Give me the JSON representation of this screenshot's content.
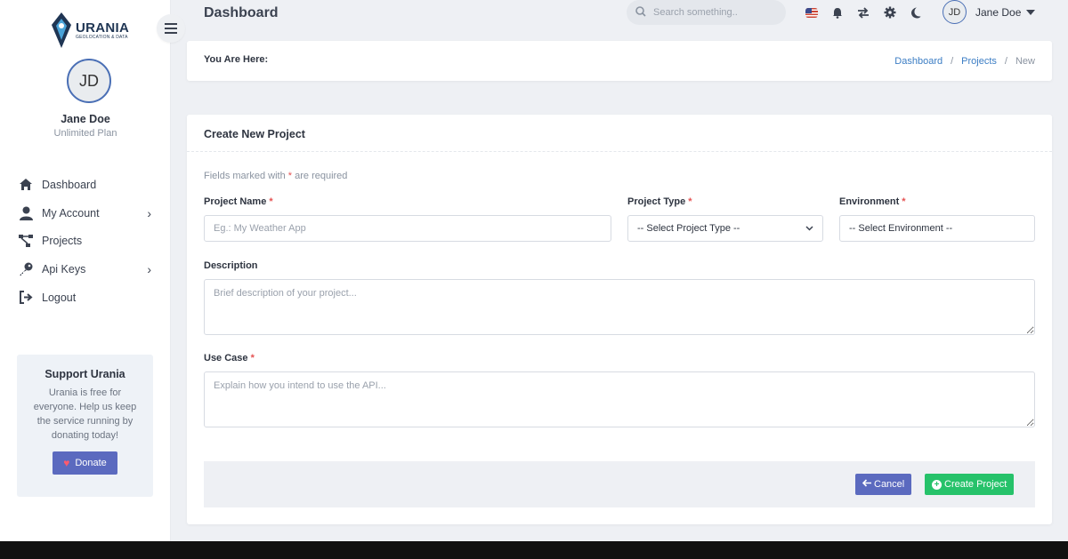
{
  "brand": {
    "name": "URANIA",
    "tagline": "GEOLOCATION & DATA"
  },
  "user": {
    "initials": "JD",
    "name": "Jane Doe",
    "plan": "Unlimited Plan"
  },
  "sidebar": {
    "items": [
      {
        "label": "Dashboard",
        "icon": "home-icon"
      },
      {
        "label": "My Account",
        "icon": "user-icon",
        "expandable": true
      },
      {
        "label": "Projects",
        "icon": "projects-icon"
      },
      {
        "label": "Api Keys",
        "icon": "key-icon",
        "expandable": true
      },
      {
        "label": "Logout",
        "icon": "logout-icon"
      }
    ]
  },
  "support": {
    "title": "Support Urania",
    "text": "Urania is free for everyone. Help us keep the service running by donating today!",
    "donate_label": "Donate"
  },
  "header": {
    "title": "Dashboard",
    "search_placeholder": "Search something..",
    "user_name": "Jane Doe"
  },
  "breadcrumb": {
    "prefix": "You Are Here:",
    "items": [
      "Dashboard",
      "Projects",
      "New"
    ],
    "separator": "/"
  },
  "form": {
    "title": "Create New Project",
    "required_note_before": "Fields marked with",
    "required_star": "*",
    "required_note_after": "are required",
    "project_name": {
      "label": "Project Name",
      "placeholder": "Eg.: My Weather App",
      "value": ""
    },
    "project_type": {
      "label": "Project Type",
      "selected": "-- Select Project Type --"
    },
    "environment": {
      "label": "Environment",
      "selected": "-- Select Environment --"
    },
    "description": {
      "label": "Description",
      "placeholder": "Brief description of your project..."
    },
    "use_case": {
      "label": "Use Case",
      "placeholder": "Explain how you intend to use the API..."
    },
    "cancel_label": "Cancel",
    "create_label": "Create Project"
  },
  "colors": {
    "primary": "#5b6abf",
    "success": "#26c26a",
    "link": "#3b7dc4",
    "required": "#e55353"
  }
}
